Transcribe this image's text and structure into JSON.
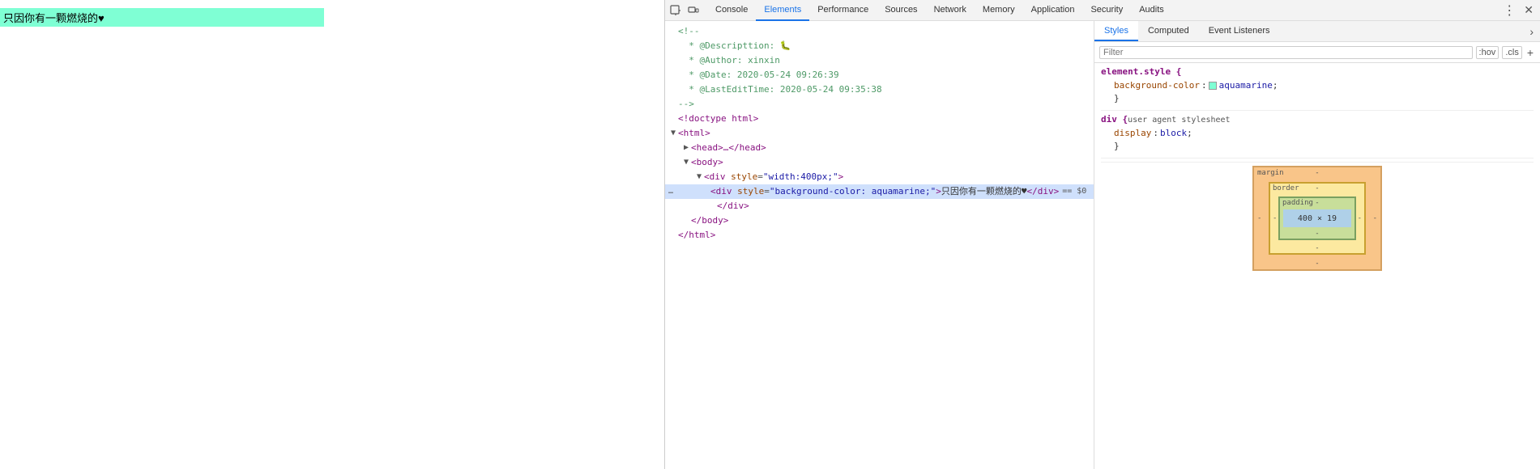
{
  "preview": {
    "text": "只因你有一颗燃烧的♥"
  },
  "devtools": {
    "tabs": [
      {
        "id": "console",
        "label": "Console",
        "active": false
      },
      {
        "id": "elements",
        "label": "Elements",
        "active": true
      },
      {
        "id": "performance",
        "label": "Performance",
        "active": false
      },
      {
        "id": "sources",
        "label": "Sources",
        "active": false
      },
      {
        "id": "network",
        "label": "Network",
        "active": false
      },
      {
        "id": "memory",
        "label": "Memory",
        "active": false
      },
      {
        "id": "application",
        "label": "Application",
        "active": false
      },
      {
        "id": "security",
        "label": "Security",
        "active": false
      },
      {
        "id": "audits",
        "label": "Audits",
        "active": false
      }
    ],
    "elements_panel": {
      "lines": [
        {
          "id": "comment1",
          "type": "comment",
          "text": "<!--",
          "indent": 0
        },
        {
          "id": "comment2",
          "type": "comment",
          "text": "  * @Descripttion: 🐛",
          "indent": 0
        },
        {
          "id": "comment3",
          "type": "comment",
          "text": "  * @Author: xinxin",
          "indent": 0
        },
        {
          "id": "comment4",
          "type": "comment",
          "text": "  * @Date: 2020-05-24 09:26:39",
          "indent": 0
        },
        {
          "id": "comment5",
          "type": "comment",
          "text": "  * @LastEditTime: 2020-05-24 09:35:38",
          "indent": 0
        },
        {
          "id": "comment6",
          "type": "comment",
          "text": "-->",
          "indent": 0
        },
        {
          "id": "doctype",
          "type": "tag",
          "text": "<!doctype html>",
          "indent": 0
        },
        {
          "id": "html",
          "type": "tag",
          "text": "<html>",
          "indent": 0,
          "triangle": "open"
        },
        {
          "id": "head",
          "type": "tag",
          "text": "<head>…</head>",
          "indent": 1,
          "triangle": "closed"
        },
        {
          "id": "body",
          "type": "tag",
          "text": "<body>",
          "indent": 1,
          "triangle": "open"
        },
        {
          "id": "div1",
          "type": "tag",
          "indent": 2,
          "triangle": "open",
          "tag": "div",
          "attr_name": "style",
          "attr_value": "\"width:400px;\""
        },
        {
          "id": "div2",
          "type": "selected",
          "indent": 3,
          "triangle": "empty",
          "tag": "div",
          "attr_name": "style",
          "attr_value": "\"background-color: aquamarine;\"",
          "inner": "只因你有一颗燃烧的♥",
          "selected": true
        },
        {
          "id": "div1close",
          "type": "tag",
          "text": "</div>",
          "indent": 2
        },
        {
          "id": "bodyclose",
          "type": "tag",
          "text": "</body>",
          "indent": 1
        },
        {
          "id": "htmlclose",
          "type": "tag",
          "text": "</html>",
          "indent": 0
        }
      ]
    },
    "styles_panel": {
      "tabs": [
        {
          "id": "styles",
          "label": "Styles",
          "active": true
        },
        {
          "id": "computed",
          "label": "Computed",
          "active": false
        },
        {
          "id": "event-listeners",
          "label": "Event Listeners",
          "active": false
        }
      ],
      "filter_placeholder": "Filter",
      "hov_label": ":hov",
      "cls_label": ".cls",
      "plus_label": "+",
      "rules": [
        {
          "selector": "element.style {",
          "source": "",
          "properties": [
            {
              "name": "background-color",
              "value": "aquamarine",
              "color_swatch": "aquamarine"
            }
          ]
        },
        {
          "selector": "div {",
          "source": "user agent stylesheet",
          "properties": [
            {
              "name": "display",
              "value": "block"
            }
          ]
        }
      ],
      "box_model": {
        "margin_label": "margin",
        "border_label": "border",
        "padding_label": "padding",
        "content_size": "400 × 19",
        "minus": "-",
        "dimensions": {
          "margin": {
            "top": "-",
            "right": "-",
            "bottom": "-",
            "left": "-"
          },
          "border": {
            "top": "-",
            "right": "-",
            "bottom": "-",
            "left": "-"
          },
          "padding": {
            "top": "-",
            "right": "-",
            "bottom": "-",
            "left": "-"
          }
        }
      }
    }
  }
}
